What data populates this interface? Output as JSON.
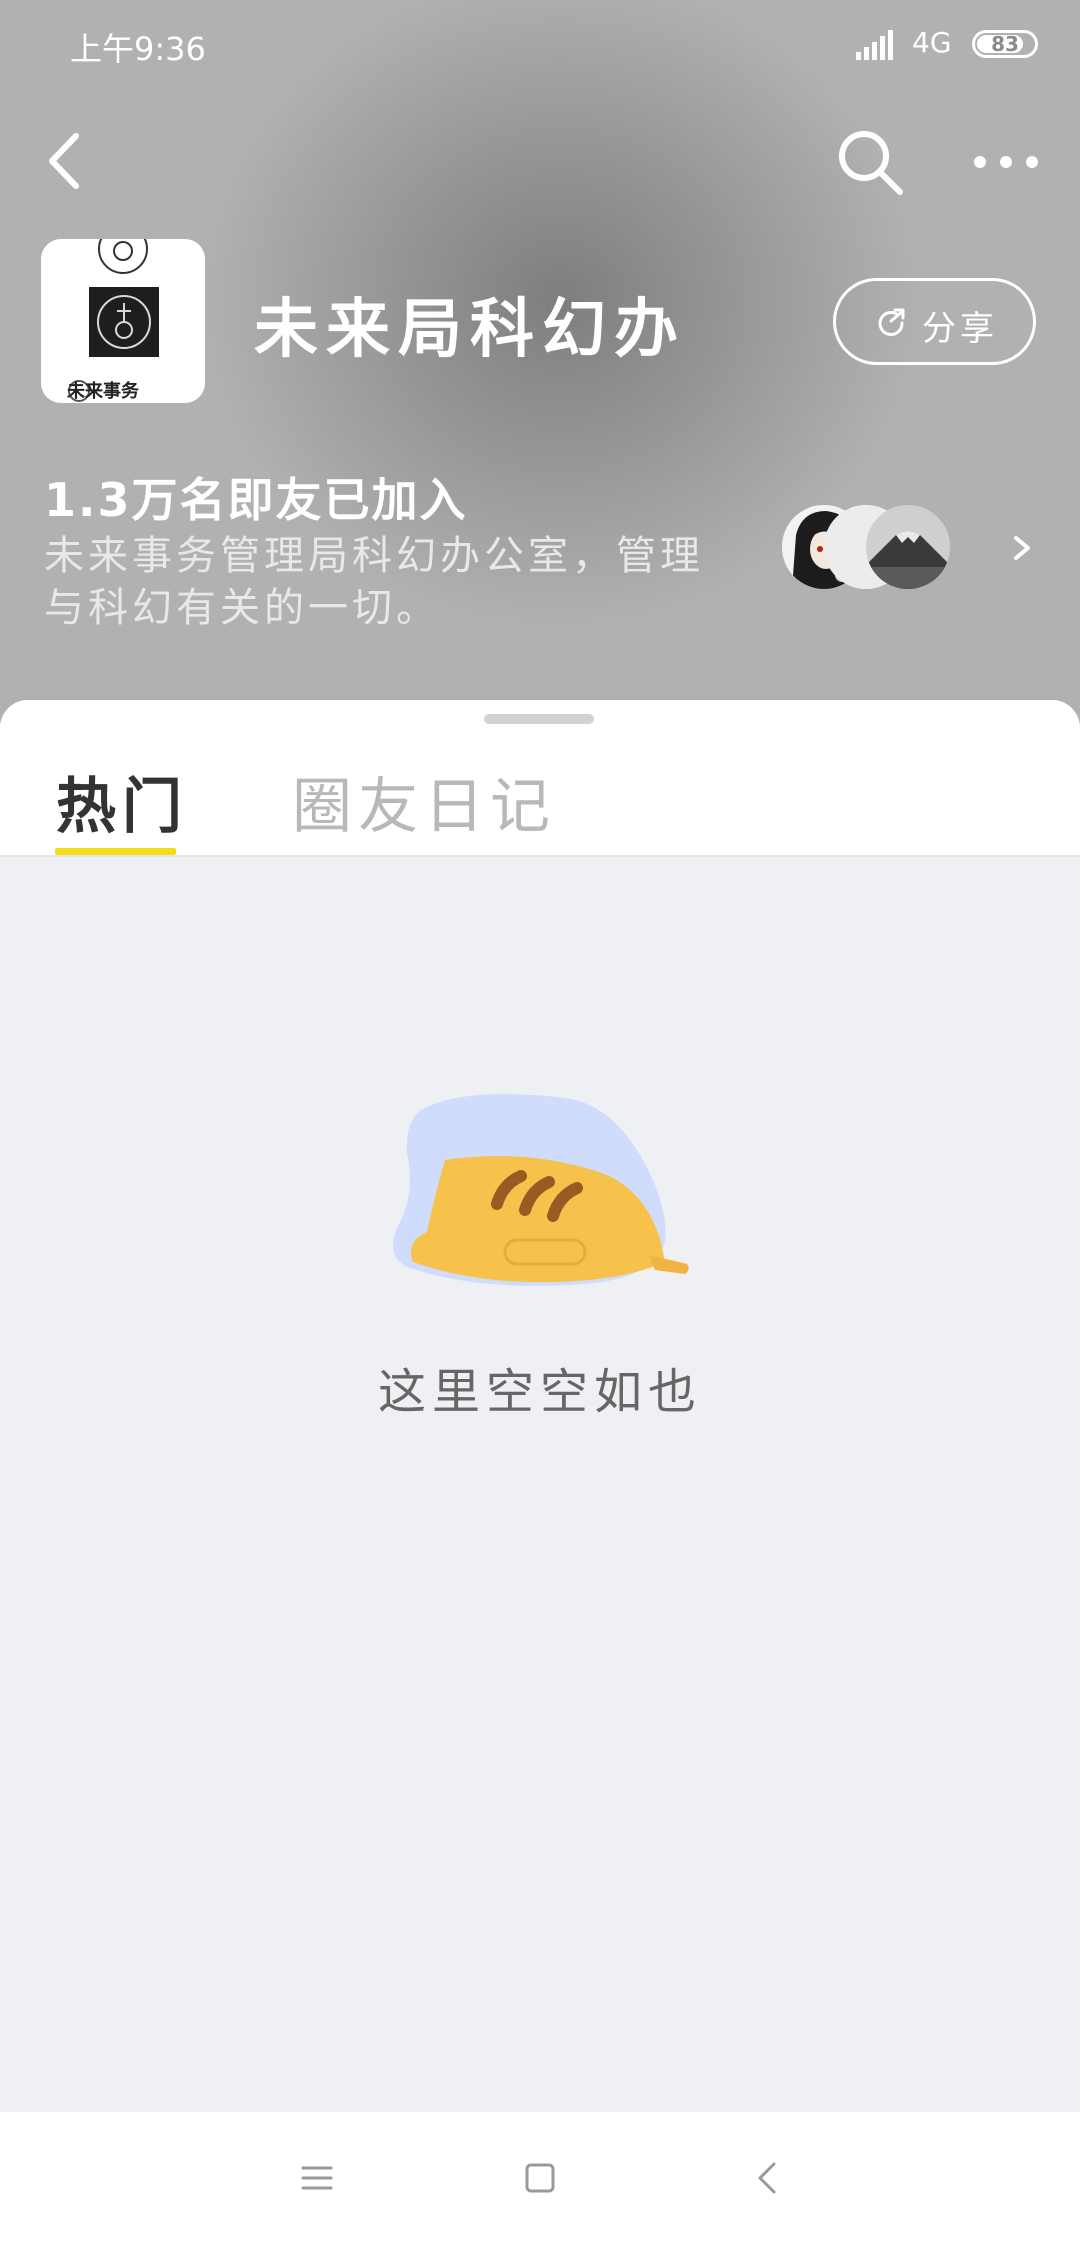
{
  "status_bar": {
    "time": "上午9:36",
    "network": "4G",
    "battery": "83",
    "battery_level": 0.83
  },
  "header": {
    "back_icon": "chevron-left-icon",
    "search_icon": "search-icon",
    "more_icon": "more-dots-icon",
    "logo_text": "未来事务",
    "circle_name": "未来局科幻办",
    "share_label": "分享",
    "share_icon": "share-arrow-icon",
    "member_count": "1.3万名即友已加入",
    "description": "未来事务管理局科幻办公室，管理与科幻有关的一切。",
    "members_arrow_icon": "chevron-right-icon"
  },
  "tabs": [
    {
      "label": "热门",
      "active": true
    },
    {
      "label": "圈友日记",
      "active": false
    }
  ],
  "empty_state": {
    "text": "这里空空如也",
    "illustration": "sleeping-cat-illustration"
  },
  "nav_bar": {
    "menu_icon": "menu-icon",
    "home_icon": "square-home-icon",
    "back_icon": "triangle-back-icon"
  },
  "colors": {
    "accent": "#f5dc1b",
    "header_gray": "#9a9a9a",
    "background": "#eef0f3"
  }
}
